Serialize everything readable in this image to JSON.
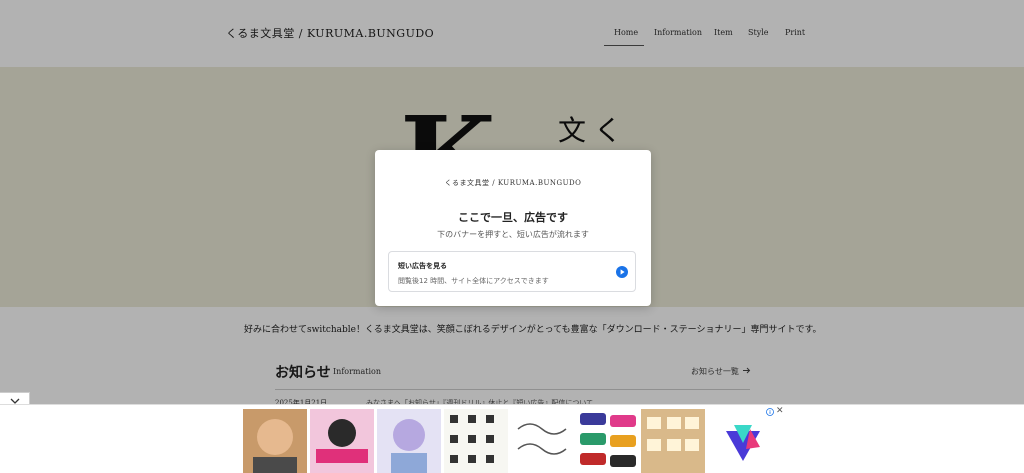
{
  "header": {
    "logo": "くるま文具堂 / KURUMA.BUNGUDO",
    "nav": [
      "Home",
      "Information",
      "Item",
      "Style",
      "Print"
    ]
  },
  "hero": {
    "letter": "K",
    "kanji": "文く"
  },
  "tagline": "好みに合わせてswitchable！くるま文具堂は、笑顔こぼれるデザインがとっても豊富な「ダウンロード・ステーショナリー」専門サイトです。",
  "news": {
    "title": "お知らせ",
    "subtitle": "Information",
    "link": "お知らせ一覧",
    "date": "2025年1月21日",
    "text": "みなさまへ「お知らせ」『週刊ドリル』休止と『短い広告』配信について"
  },
  "modal": {
    "logo": "くるま文具堂 / KURUMA.BUNGUDO",
    "title": "ここで一旦、広告です",
    "subtitle": "下のバナーを押すと、短い広告が流れます",
    "card_title": "短い広告を見る",
    "card_subtitle": "閲覧後12 時間、サイト全体にアクセスできます"
  },
  "ad": {
    "close": "✕"
  },
  "colors": {
    "hero_bg": "#ecebd9",
    "accent_blue": "#1a73e8"
  }
}
